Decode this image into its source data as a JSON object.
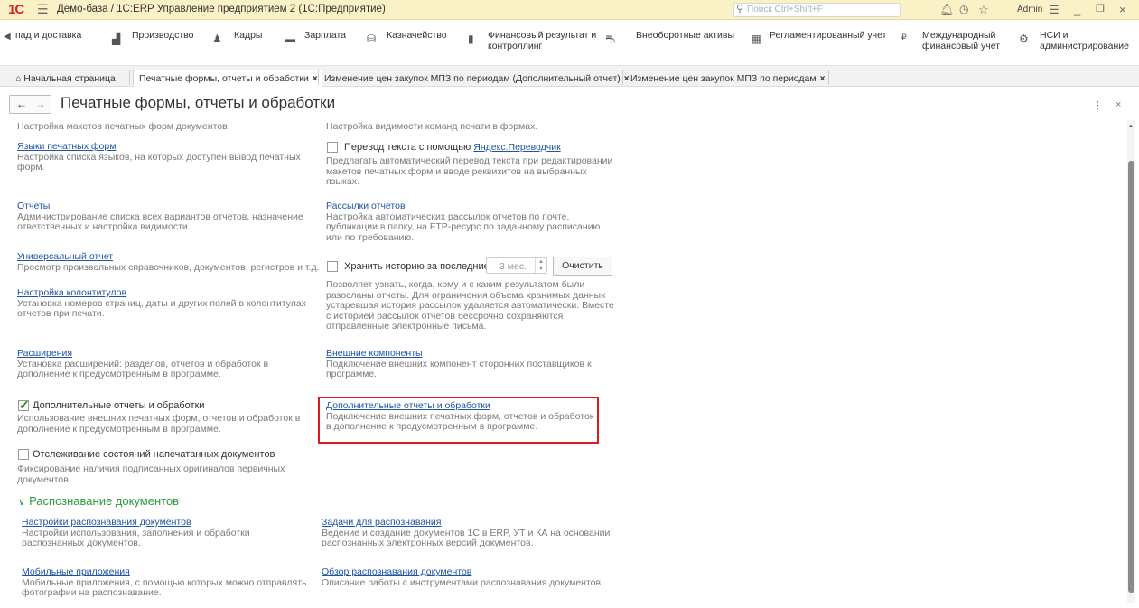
{
  "titlebar": {
    "logo": "1С",
    "title": "Демо-база / 1С:ERP Управление предприятием 2  (1С:Предприятие)",
    "search_placeholder": "Поиск Ctrl+Shift+F",
    "user": "Admin"
  },
  "sections": [
    {
      "label": "пад и доставка",
      "icon": "warehouse-icon"
    },
    {
      "label": "Производство",
      "icon": "factory-icon"
    },
    {
      "label": "Кадры",
      "icon": "person-icon"
    },
    {
      "label": "Зарплата",
      "icon": "money-icon"
    },
    {
      "label": "Казначейство",
      "icon": "treasury-icon"
    },
    {
      "label": "Финансовый результат и",
      "label2": "контроллинг",
      "icon": "chart-icon"
    },
    {
      "label": "Внеоборотные активы",
      "icon": "car-icon"
    },
    {
      "label": "Регламентированный учет",
      "icon": "calculator-icon"
    },
    {
      "label": "Международный",
      "label2": "финансовый учет",
      "icon": "currency-icon"
    },
    {
      "label": "НСИ и",
      "label2": "администрирование",
      "icon": "gear-icon"
    }
  ],
  "tabs": {
    "home": "Начальная страница",
    "t1": "Печатные формы, отчеты и обработки",
    "t2": "Изменение цен закупок МПЗ по периодам (Дополнительный отчет)",
    "t3": "Изменение цен закупок МПЗ по периодам",
    "close": "×"
  },
  "form": {
    "title": "Печатные формы, отчеты и обработки"
  },
  "left": {
    "intro": "Настройка макетов печатных форм документов.",
    "languages_link": "Языки печатных форм",
    "languages_desc": "Настройка списка языков, на которых доступен вывод печатных форм.",
    "reports_link": "Отчеты",
    "reports_desc": "Администрирование списка всех вариантов отчетов, назначение ответственных и настройка видимости.",
    "universal_link": "Универсальный отчет",
    "universal_desc": "Просмотр произвольных справочников, документов, регистров и т.д.",
    "headers_link": "Настройка колонтитулов",
    "headers_desc": "Установка номеров страниц, даты и других полей в колонтитулах отчетов при печати.",
    "ext_link": "Расширения",
    "ext_desc": "Установка расширений: разделов, отчетов и обработок в дополнение к предусмотренным в программе.",
    "addl_cb": "Дополнительные отчеты и обработки",
    "addl_desc": "Использование внешних печатных форм, отчетов и обработок в дополнение к предусмотренным в программе.",
    "track_cb": "Отслеживание состояний напечатанных документов",
    "track_desc": "Фиксирование наличия подписанных оригиналов первичных документов."
  },
  "right": {
    "intro": "Настройка видимости команд печати в формах.",
    "translate_cb": "Перевод текста с помощью",
    "translate_link": "Яндекс.Переводчик",
    "translate_desc": "Предлагать автоматический перевод текста при редактировании макетов печатных форм и вводе реквизитов на выбранных языках.",
    "mail_link": "Рассылки отчетов",
    "mail_desc": "Настройка автоматических рассылок отчетов по почте, публикации в папку, на FTP-ресурс по заданному расписанию или по требованию.",
    "history_cb": "Хранить историю за последние",
    "history_value": "3 мес.",
    "clear_btn": "Очистить",
    "history_desc": "Позволяет узнать, когда, кому и с каким результатом были разосланы отчеты. Для ограничения объема хранимых данных устаревшая история рассылок удаляется автоматически. Вместе с историей рассылок отчетов бессрочно сохраняются отправленные электронные письма.",
    "components_link": "Внешние компоненты",
    "components_desc": "Подключение внешних компонент сторонних поставщиков к программе.",
    "addl_link": "Дополнительные отчеты и обработки",
    "addl_desc": "Подключение внешних печатных форм, отчетов и обработок в дополнение к предусмотренным в программе."
  },
  "recognition": {
    "group_title": "Распознавание документов",
    "settings_link": "Настройки распознавания документов",
    "settings_desc": "Настройки использования, заполнения и обработки распознанных документов.",
    "tasks_link": "Задачи для распознавания",
    "tasks_desc": "Ведение и создание документов 1С в ERP, УТ и КА на основании распознанных электронных версий документов.",
    "mobile_link": "Мобильные приложения",
    "mobile_desc": "Мобильные приложения, с помощью которых можно отправлять фотографии на распознавание.",
    "overview_link": "Обзор распознавания документов",
    "overview_desc": "Описание работы с инструментами распознавания документов."
  }
}
